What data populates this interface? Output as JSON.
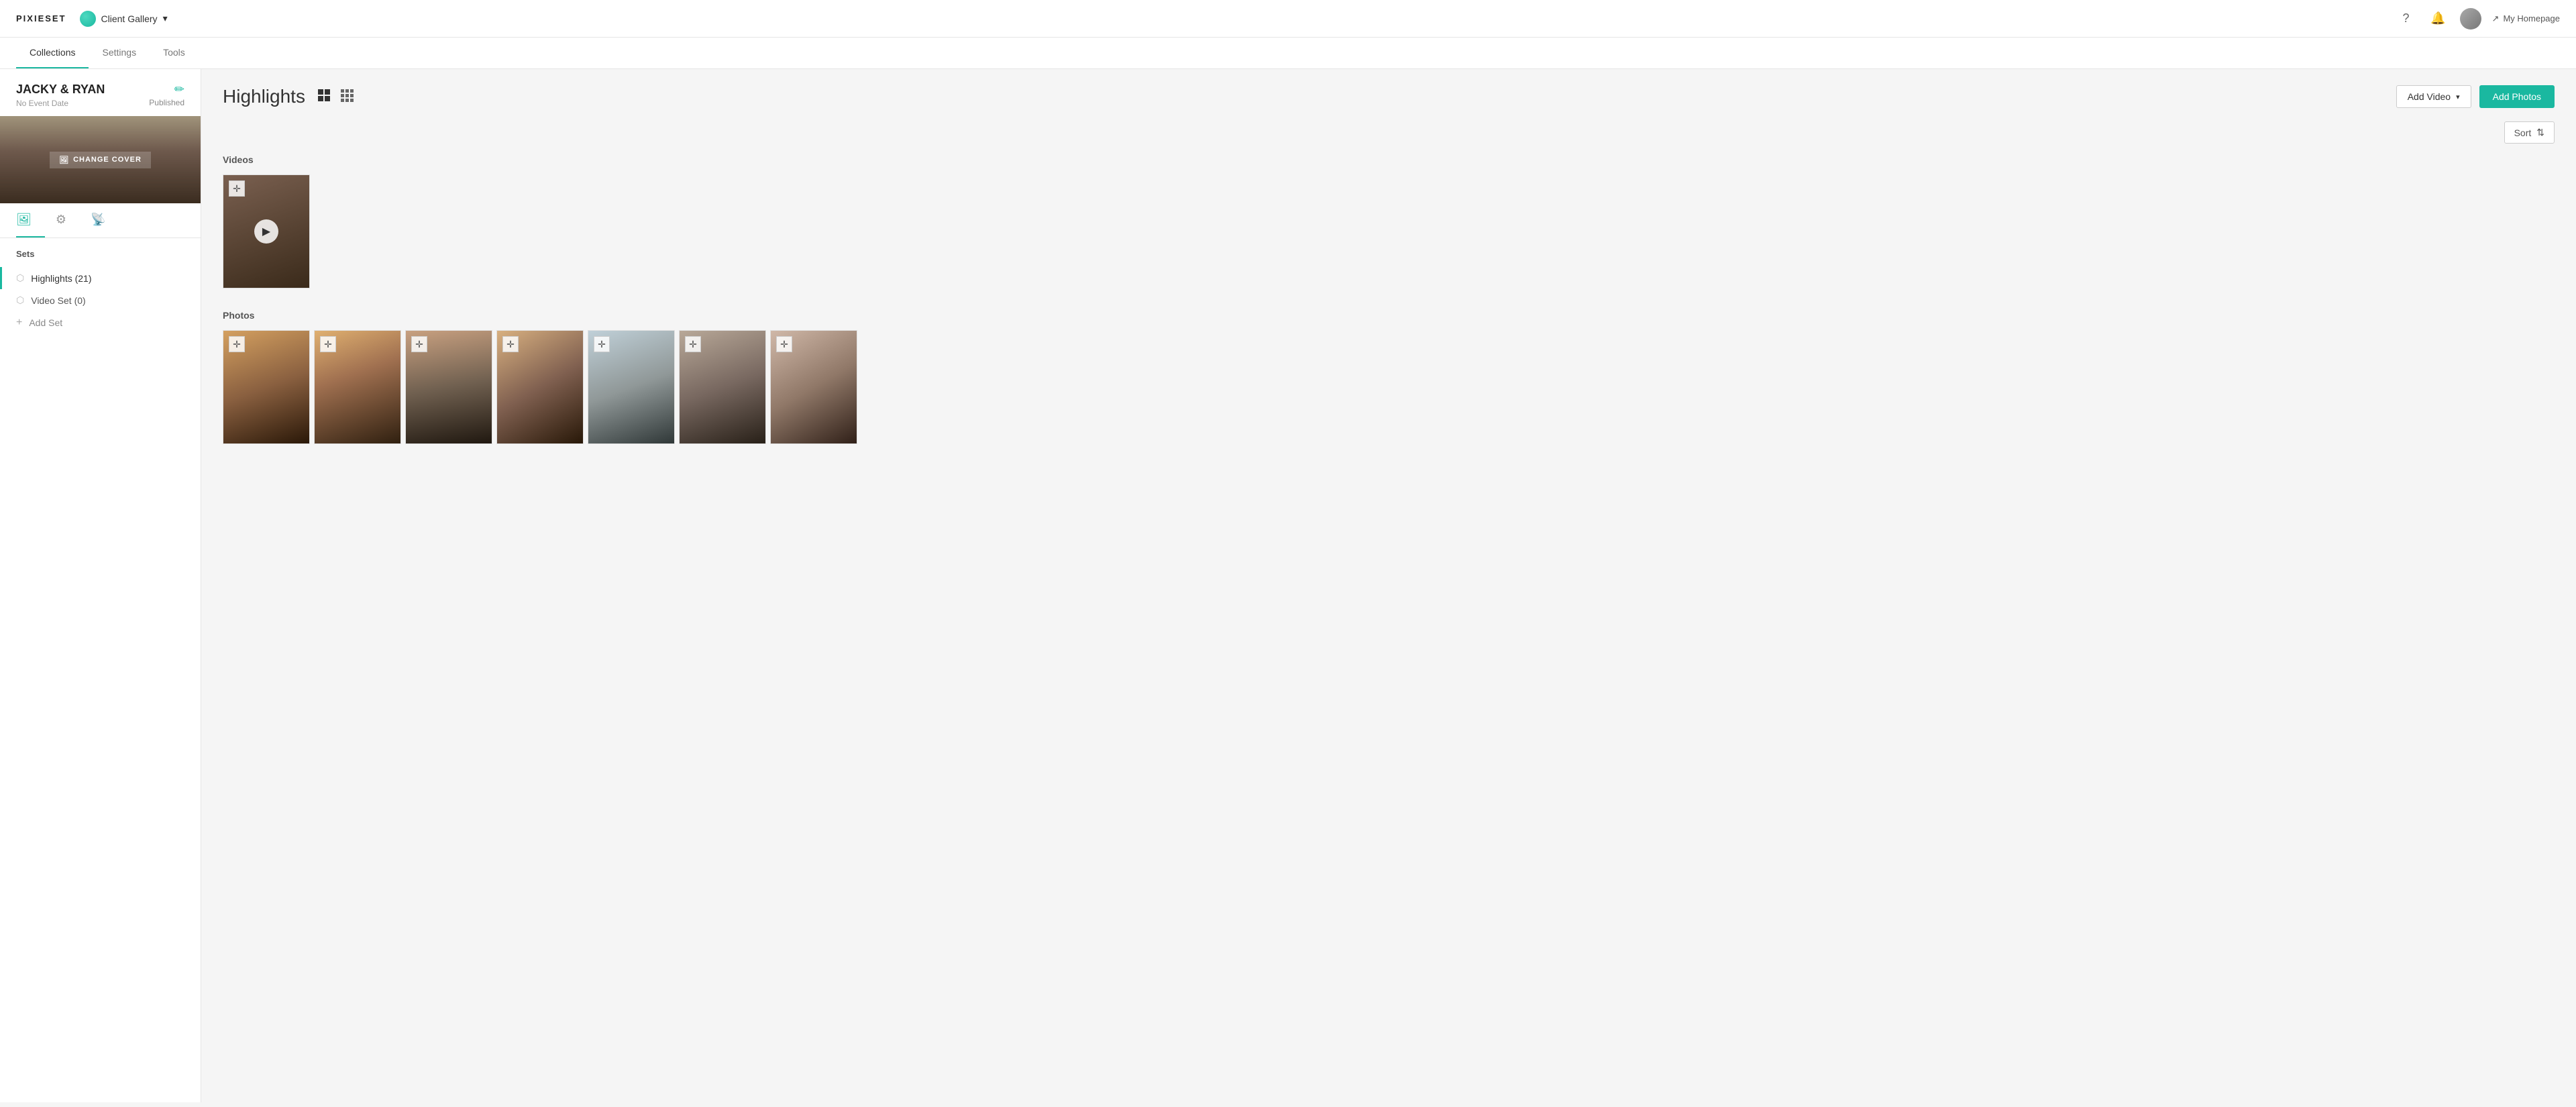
{
  "logo": "PIXIESET",
  "gallery": {
    "name": "Client Gallery",
    "icon": "globe-icon"
  },
  "nav_icons": {
    "help": "?",
    "bell": "🔔",
    "avatar": "avatar-icon"
  },
  "my_homepage": {
    "label": "My Homepage",
    "icon": "external-link-icon"
  },
  "sub_nav": {
    "tabs": [
      {
        "label": "Collections",
        "active": true
      },
      {
        "label": "Settings",
        "active": false
      },
      {
        "label": "Tools",
        "active": false
      }
    ]
  },
  "sidebar": {
    "client_name": "JACKY & RYAN",
    "event_date": "No Event Date",
    "status": "Published",
    "edit_icon": "✏",
    "change_cover_label": "CHANGE COVER",
    "tabs": [
      {
        "label": "image-icon",
        "icon": "🖼",
        "active": true
      },
      {
        "label": "settings-icon",
        "icon": "⚙",
        "active": false
      },
      {
        "label": "rss-icon",
        "icon": "📡",
        "active": false
      }
    ],
    "sets_label": "Sets",
    "sets": [
      {
        "label": "Highlights (21)",
        "active": true
      },
      {
        "label": "Video Set (0)",
        "active": false
      }
    ],
    "add_set_label": "Add Set"
  },
  "main": {
    "title": "Highlights",
    "view_grid_large": "▪▪",
    "view_grid_small": "⋮⋮",
    "add_video_label": "Add Video",
    "add_photos_label": "Add Photos",
    "sort_label": "Sort",
    "videos_section_label": "Videos",
    "photos_section_label": "Photos",
    "photos": [
      {
        "id": 1,
        "class": "photo-thumb-1"
      },
      {
        "id": 2,
        "class": "photo-thumb-2"
      },
      {
        "id": 3,
        "class": "photo-thumb-3"
      },
      {
        "id": 4,
        "class": "photo-thumb-4"
      },
      {
        "id": 5,
        "class": "photo-thumb-5"
      },
      {
        "id": 6,
        "class": "photo-thumb-6"
      },
      {
        "id": 7,
        "class": "photo-thumb-7"
      }
    ]
  },
  "colors": {
    "accent": "#1ab8a0",
    "text_dark": "#222",
    "text_mid": "#555",
    "text_light": "#999",
    "border": "#e5e5e5"
  }
}
